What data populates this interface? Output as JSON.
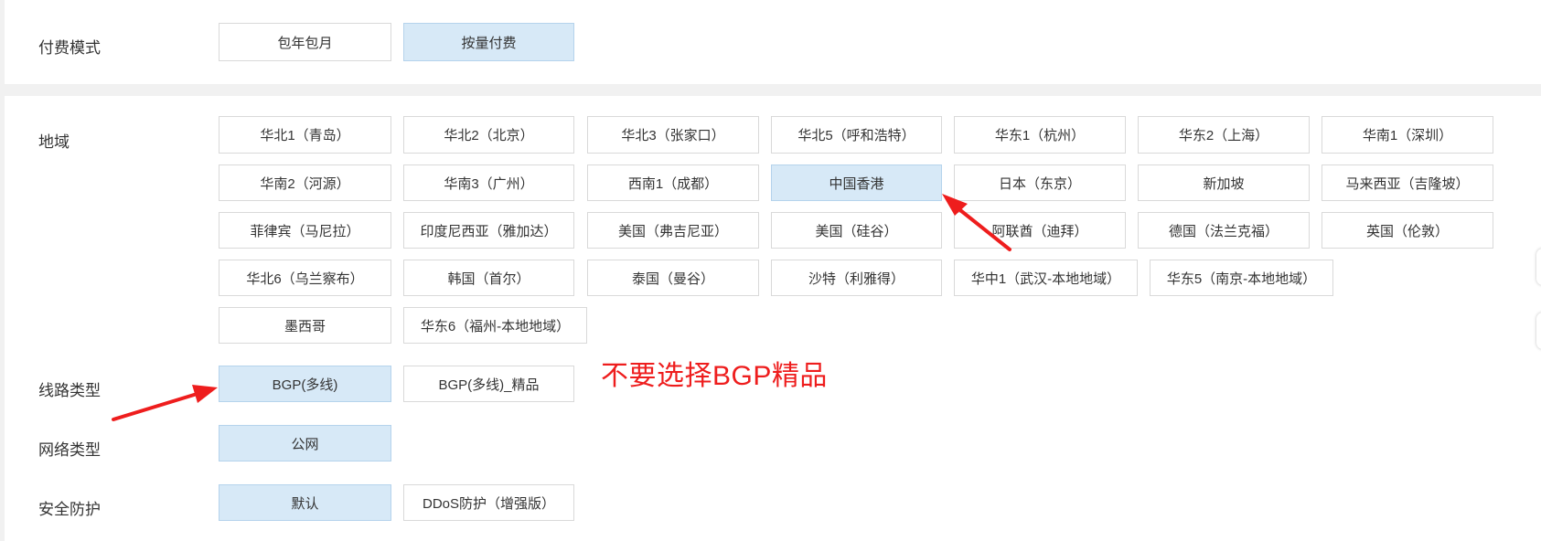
{
  "billing": {
    "label": "付费模式",
    "options": [
      "包年包月",
      "按量付费"
    ]
  },
  "region": {
    "label": "地域",
    "options": [
      "华北1（青岛）",
      "华北2（北京）",
      "华北3（张家口）",
      "华北5（呼和浩特）",
      "华东1（杭州）",
      "华东2（上海）",
      "华南1（深圳）",
      "华南2（河源）",
      "华南3（广州）",
      "西南1（成都）",
      "中国香港",
      "日本（东京）",
      "新加坡",
      "马来西亚（吉隆坡）",
      "菲律宾（马尼拉）",
      "印度尼西亚（雅加达）",
      "美国（弗吉尼亚）",
      "美国（硅谷）",
      "阿联酋（迪拜）",
      "德国（法兰克福）",
      "英国（伦敦）",
      "华北6（乌兰察布）",
      "韩国（首尔）",
      "泰国（曼谷）",
      "沙特（利雅得）",
      "华中1（武汉-本地地域）",
      "华东5（南京-本地地域）",
      "墨西哥",
      "华东6（福州-本地地域）"
    ]
  },
  "line": {
    "label": "线路类型",
    "options": [
      "BGP(多线)",
      "BGP(多线)_精品"
    ]
  },
  "network": {
    "label": "网络类型",
    "options": [
      "公网"
    ]
  },
  "security": {
    "label": "安全防护",
    "options": [
      "默认",
      "DDoS防护（增强版）"
    ]
  },
  "annotation": {
    "note": "不要选择BGP精品",
    "color": "#ee1d1d"
  },
  "colors": {
    "selected_bg": "#d7e9f7",
    "selected_border": "#b5d3ec",
    "border": "#d9d9d9"
  }
}
